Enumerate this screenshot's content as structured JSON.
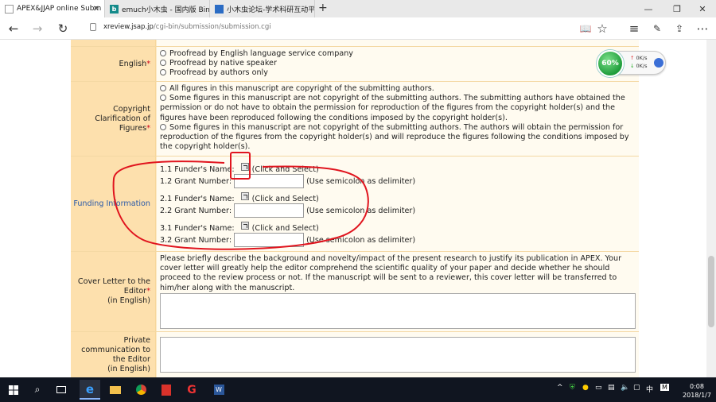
{
  "tabs": [
    {
      "label": "APEX&JJAP online Subm",
      "active": true
    },
    {
      "label": "emuch小木虫 - 国内版 Bing",
      "active": false
    },
    {
      "label": "小木虫论坛-学术科研互动平",
      "active": false
    }
  ],
  "address": {
    "domain": "xreview.jsap.jp",
    "path": "/cgi-bin/submission/submission.cgi"
  },
  "widget": {
    "percent": "60%",
    "up": "0K/s",
    "down": "0K/s"
  },
  "english": {
    "label": "English",
    "required": "*",
    "options": [
      "Proofread by English language service company",
      "Proofread by native speaker",
      "Proofread by authors only"
    ]
  },
  "copyright": {
    "label_lines": [
      "Copyright",
      "Clarification of",
      "Figures"
    ],
    "required": "*",
    "options": [
      "All figures in this manuscript are copyright of the submitting authors.",
      "Some figures in this manuscript are not copyright of the submitting authors. The submitting authors have obtained the permission or do not have to obtain the permission for reproduction of the figures from the copyright holder(s) and the figures have been reproduced following the conditions imposed by the copyright holder(s).",
      "Some figures in this manuscript are not copyright of the submitting authors. The authors will obtain the permission for reproduction of the figures from the copyright holder(s) and will reproduce the figures following the conditions imposed by the copyright holder(s)."
    ]
  },
  "funding": {
    "label": "Funding Information",
    "funders": [
      {
        "name_label": "1.1 Funder's Name:",
        "select_hint": "(Click and Select)",
        "grant_label": "1.2 Grant Number:",
        "grant_hint": "(Use semicolon as delimiter)"
      },
      {
        "name_label": "2.1 Funder's Name:",
        "select_hint": "(Click and Select)",
        "grant_label": "2.2 Grant Number:",
        "grant_hint": "(Use semicolon as delimiter)"
      },
      {
        "name_label": "3.1 Funder's Name:",
        "select_hint": "(Click and Select)",
        "grant_label": "3.2 Grant Number:",
        "grant_hint": "(Use semicolon as delimiter)"
      }
    ]
  },
  "cover_letter": {
    "label_lines": [
      "Cover Letter to the",
      "Editor",
      "(in English)"
    ],
    "required": "*",
    "instructions": "Please briefly describe the background and novelty/impact of the present research to justify its publication in APEX. Your cover letter will greatly help the editor comprehend the scientific quality of your paper and decide whether he should proceed to the review process or not. If the manuscript will be sent to a reviewer, this cover letter will be transferred to him/her along with the manuscript."
  },
  "private": {
    "label_lines": [
      "Private",
      "communication to",
      "the Editor",
      "(in English)"
    ]
  },
  "taskbar": {
    "tray_lang": "中",
    "tray_ime": "M",
    "time": "0:08",
    "date": "2018/1/7"
  },
  "colors": {
    "label_bg": "#fde0ad",
    "content_bg": "#fffbf0",
    "required": "#d0021b",
    "annotation": "#e0141e",
    "funding_label": "#2a5aa8"
  }
}
